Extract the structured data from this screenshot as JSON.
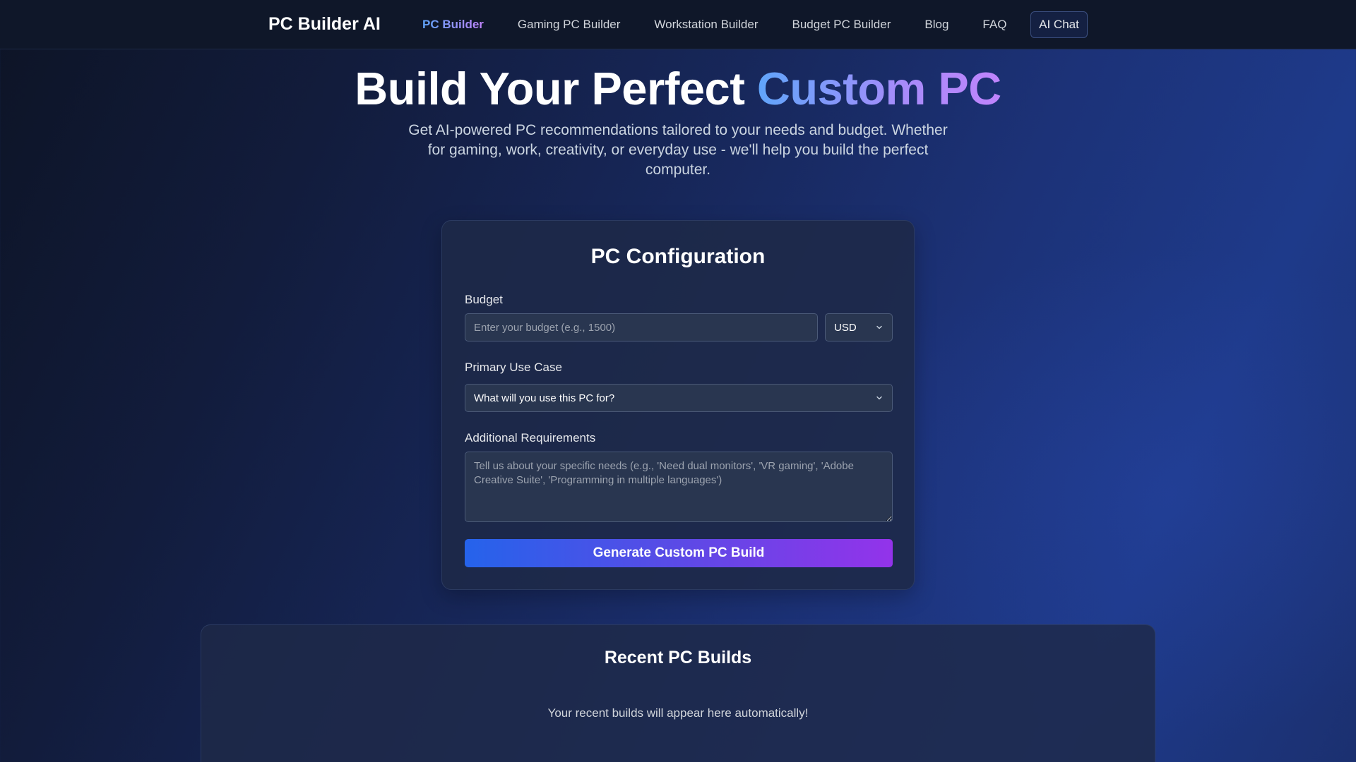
{
  "nav": {
    "brand": "PC Builder AI",
    "links": [
      "PC Builder",
      "Gaming PC Builder",
      "Workstation Builder",
      "Budget PC Builder",
      "Blog",
      "FAQ"
    ],
    "chat_label": "AI Chat"
  },
  "hero": {
    "title_main": "Build Your Perfect ",
    "title_accent": "Custom PC",
    "subtitle": "Get AI-powered PC recommendations tailored to your needs and budget. Whether for gaming, work, creativity, or everyday use - we'll help you build the perfect computer."
  },
  "config": {
    "title": "PC Configuration",
    "budget_label": "Budget",
    "budget_placeholder": "Enter your budget (e.g., 1500)",
    "currency_value": "USD",
    "use_case_label": "Primary Use Case",
    "use_case_value": "What will you use this PC for?",
    "requirements_label": "Additional Requirements",
    "requirements_placeholder": "Tell us about your specific needs (e.g., 'Need dual monitors', 'VR gaming', 'Adobe Creative Suite', 'Programming in multiple languages')",
    "generate_label": "Generate Custom PC Build"
  },
  "recent": {
    "title": "Recent PC Builds",
    "empty_text": "Your recent builds will appear here automatically!"
  },
  "colors": {
    "accent_blue": "#60a5fa",
    "accent_purple": "#c084fc",
    "button_start": "#2563eb",
    "button_end": "#9333ea"
  }
}
